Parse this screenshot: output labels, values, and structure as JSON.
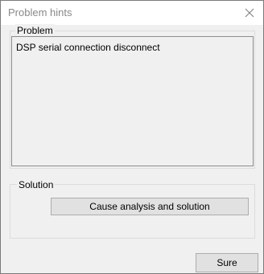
{
  "window": {
    "title": "Problem hints"
  },
  "problem": {
    "group_label": "Problem",
    "text": "DSP serial connection disconnect"
  },
  "solution": {
    "group_label": "Solution",
    "button_label": "Cause analysis and solution"
  },
  "footer": {
    "sure_label": "Sure"
  },
  "icons": {
    "close": "close-icon"
  }
}
